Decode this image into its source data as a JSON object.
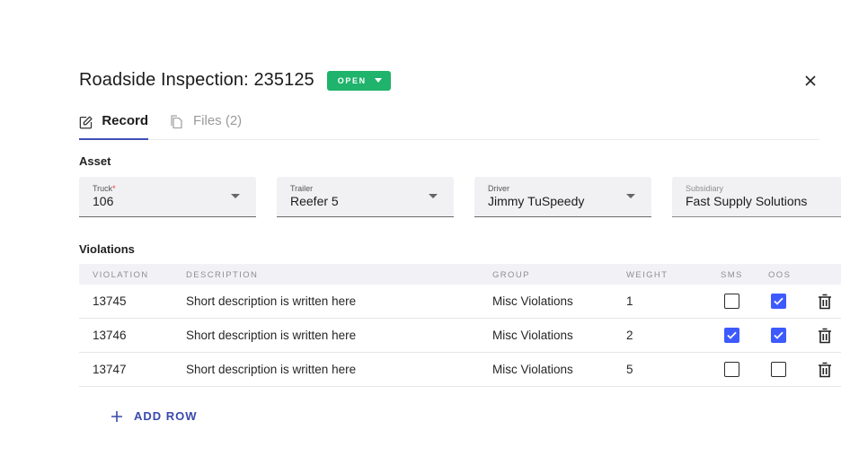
{
  "header": {
    "title": "Roadside Inspection: 235125",
    "status": "OPEN",
    "status_color": "#1fb36b",
    "close_icon": "close-icon"
  },
  "tabs": [
    {
      "label": "Record",
      "icon": "edit-icon",
      "active": true
    },
    {
      "label": "Files (2)",
      "icon": "file-copy-icon",
      "active": false
    }
  ],
  "asset": {
    "section_label": "Asset",
    "fields": {
      "truck": {
        "label": "Truck",
        "required_mark": "*",
        "value": "106"
      },
      "trailer": {
        "label": "Trailer",
        "value": "Reefer 5"
      },
      "driver": {
        "label": "Driver",
        "value": "Jimmy TuSpeedy"
      },
      "subsidiary": {
        "label": "Subsidiary",
        "value": "Fast Supply Solutions"
      }
    }
  },
  "violations": {
    "section_label": "Violations",
    "columns": {
      "violation": "VIOLATION",
      "description": "DESCRIPTION",
      "group": "GROUP",
      "weight": "WEIGHT",
      "sms": "SMS",
      "oos": "OOS"
    },
    "rows": [
      {
        "violation": "13745",
        "description": "Short description is written here",
        "group": "Misc Violations",
        "weight": "1",
        "sms": false,
        "oos": true
      },
      {
        "violation": "13746",
        "description": "Short description is written here",
        "group": "Misc Violations",
        "weight": "2",
        "sms": true,
        "oos": true
      },
      {
        "violation": "13747",
        "description": "Short description is written here",
        "group": "Misc Violations",
        "weight": "5",
        "sms": false,
        "oos": false
      }
    ],
    "add_row_label": "ADD ROW",
    "accent_color": "#3d5afe"
  }
}
